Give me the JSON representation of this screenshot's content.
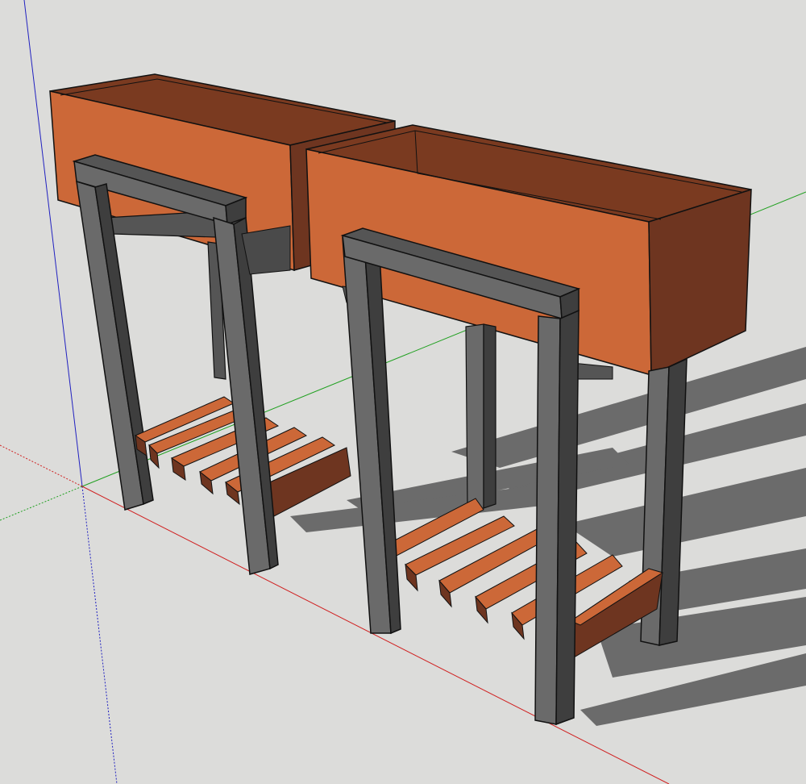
{
  "scene": {
    "description_visible_text": "",
    "colors": {
      "background": "#dcdcda",
      "wood_front": "#cc6838",
      "wood_side": "#6e3520",
      "wood_inner": "#7a3a20",
      "metal_front": "#6a6a6a",
      "metal_side": "#3e3e3e",
      "metal_top": "#555555",
      "shadow": "#6b6b6b",
      "axis_red": "#d02020",
      "axis_green": "#20a020",
      "axis_blue": "#2020c0",
      "edge": "#111111"
    },
    "objects": [
      {
        "name": "planter-stand-1",
        "parts": [
          "planter-box",
          "metal-frame",
          "slat-shelf"
        ]
      },
      {
        "name": "planter-stand-2",
        "parts": [
          "planter-box",
          "metal-frame",
          "slat-shelf"
        ]
      }
    ]
  }
}
